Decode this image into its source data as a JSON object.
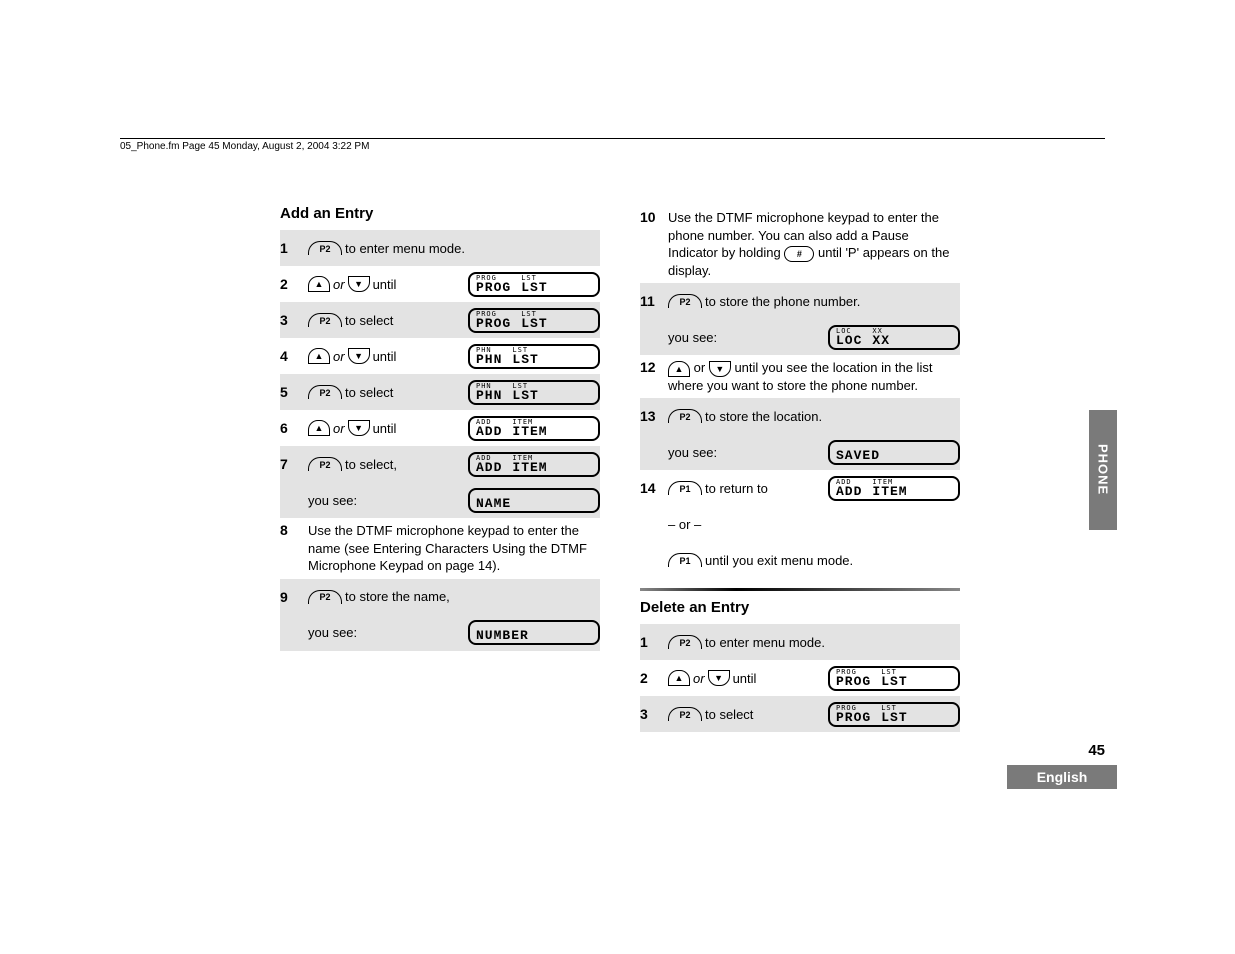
{
  "header": "05_Phone.fm  Page 45  Monday, August 2, 2004  3:22 PM",
  "add_title": "Add an Entry",
  "delete_title": "Delete an Entry",
  "steps_add": {
    "s1": "to enter menu mode.",
    "s2": "until",
    "s3": "to select",
    "s4": "until",
    "s5": "to select",
    "s6": "until",
    "s7": "to select,",
    "s7b": "you see:",
    "s8": "Use the DTMF microphone keypad to enter the name (see Entering Characters Using the DTMF Microphone Keypad on page 14).",
    "s9": "to store the name,",
    "s9b": "you see:",
    "s10": "Use the DTMF microphone keypad to enter the phone number. You can also add a Pause Indicator by holding ",
    "s10b": " until 'P' appears on the display.",
    "s11": "to store the phone number.",
    "s11b": "you see:",
    "s12a": "until you see the location in the list where you want to store the phone number.",
    "s13": "to store the location.",
    "s13b": "you see:",
    "s14": "to return to",
    "s14b": "– or –",
    "s14c": "until you exit menu mode."
  },
  "steps_del": {
    "s1": "to enter menu mode.",
    "s2": "until",
    "s3": "to select"
  },
  "or": "or",
  "lcd": {
    "prog_top1": "PROG",
    "prog_top2": "LST",
    "prog_bot1": "PROG",
    "prog_bot2": "LST",
    "phn_top1": "PHN",
    "phn_top2": "LST",
    "phn_bot1": "PHN",
    "phn_bot2": "LST",
    "add_top1": "ADD",
    "add_top2": "ITEM",
    "add_bot1": "ADD",
    "add_bot2": "ITEM",
    "name": "NAME",
    "number": "NUMBER",
    "loc_top": "LOC",
    "loc_top2": "XX",
    "loc_bot": "LOC",
    "loc_bot2": "XX",
    "saved": "SAVED"
  },
  "keys": {
    "p1": "P1",
    "p2": "P2",
    "hash": "#"
  },
  "side_tab": "PHONE",
  "page_num": "45",
  "lang": "English"
}
